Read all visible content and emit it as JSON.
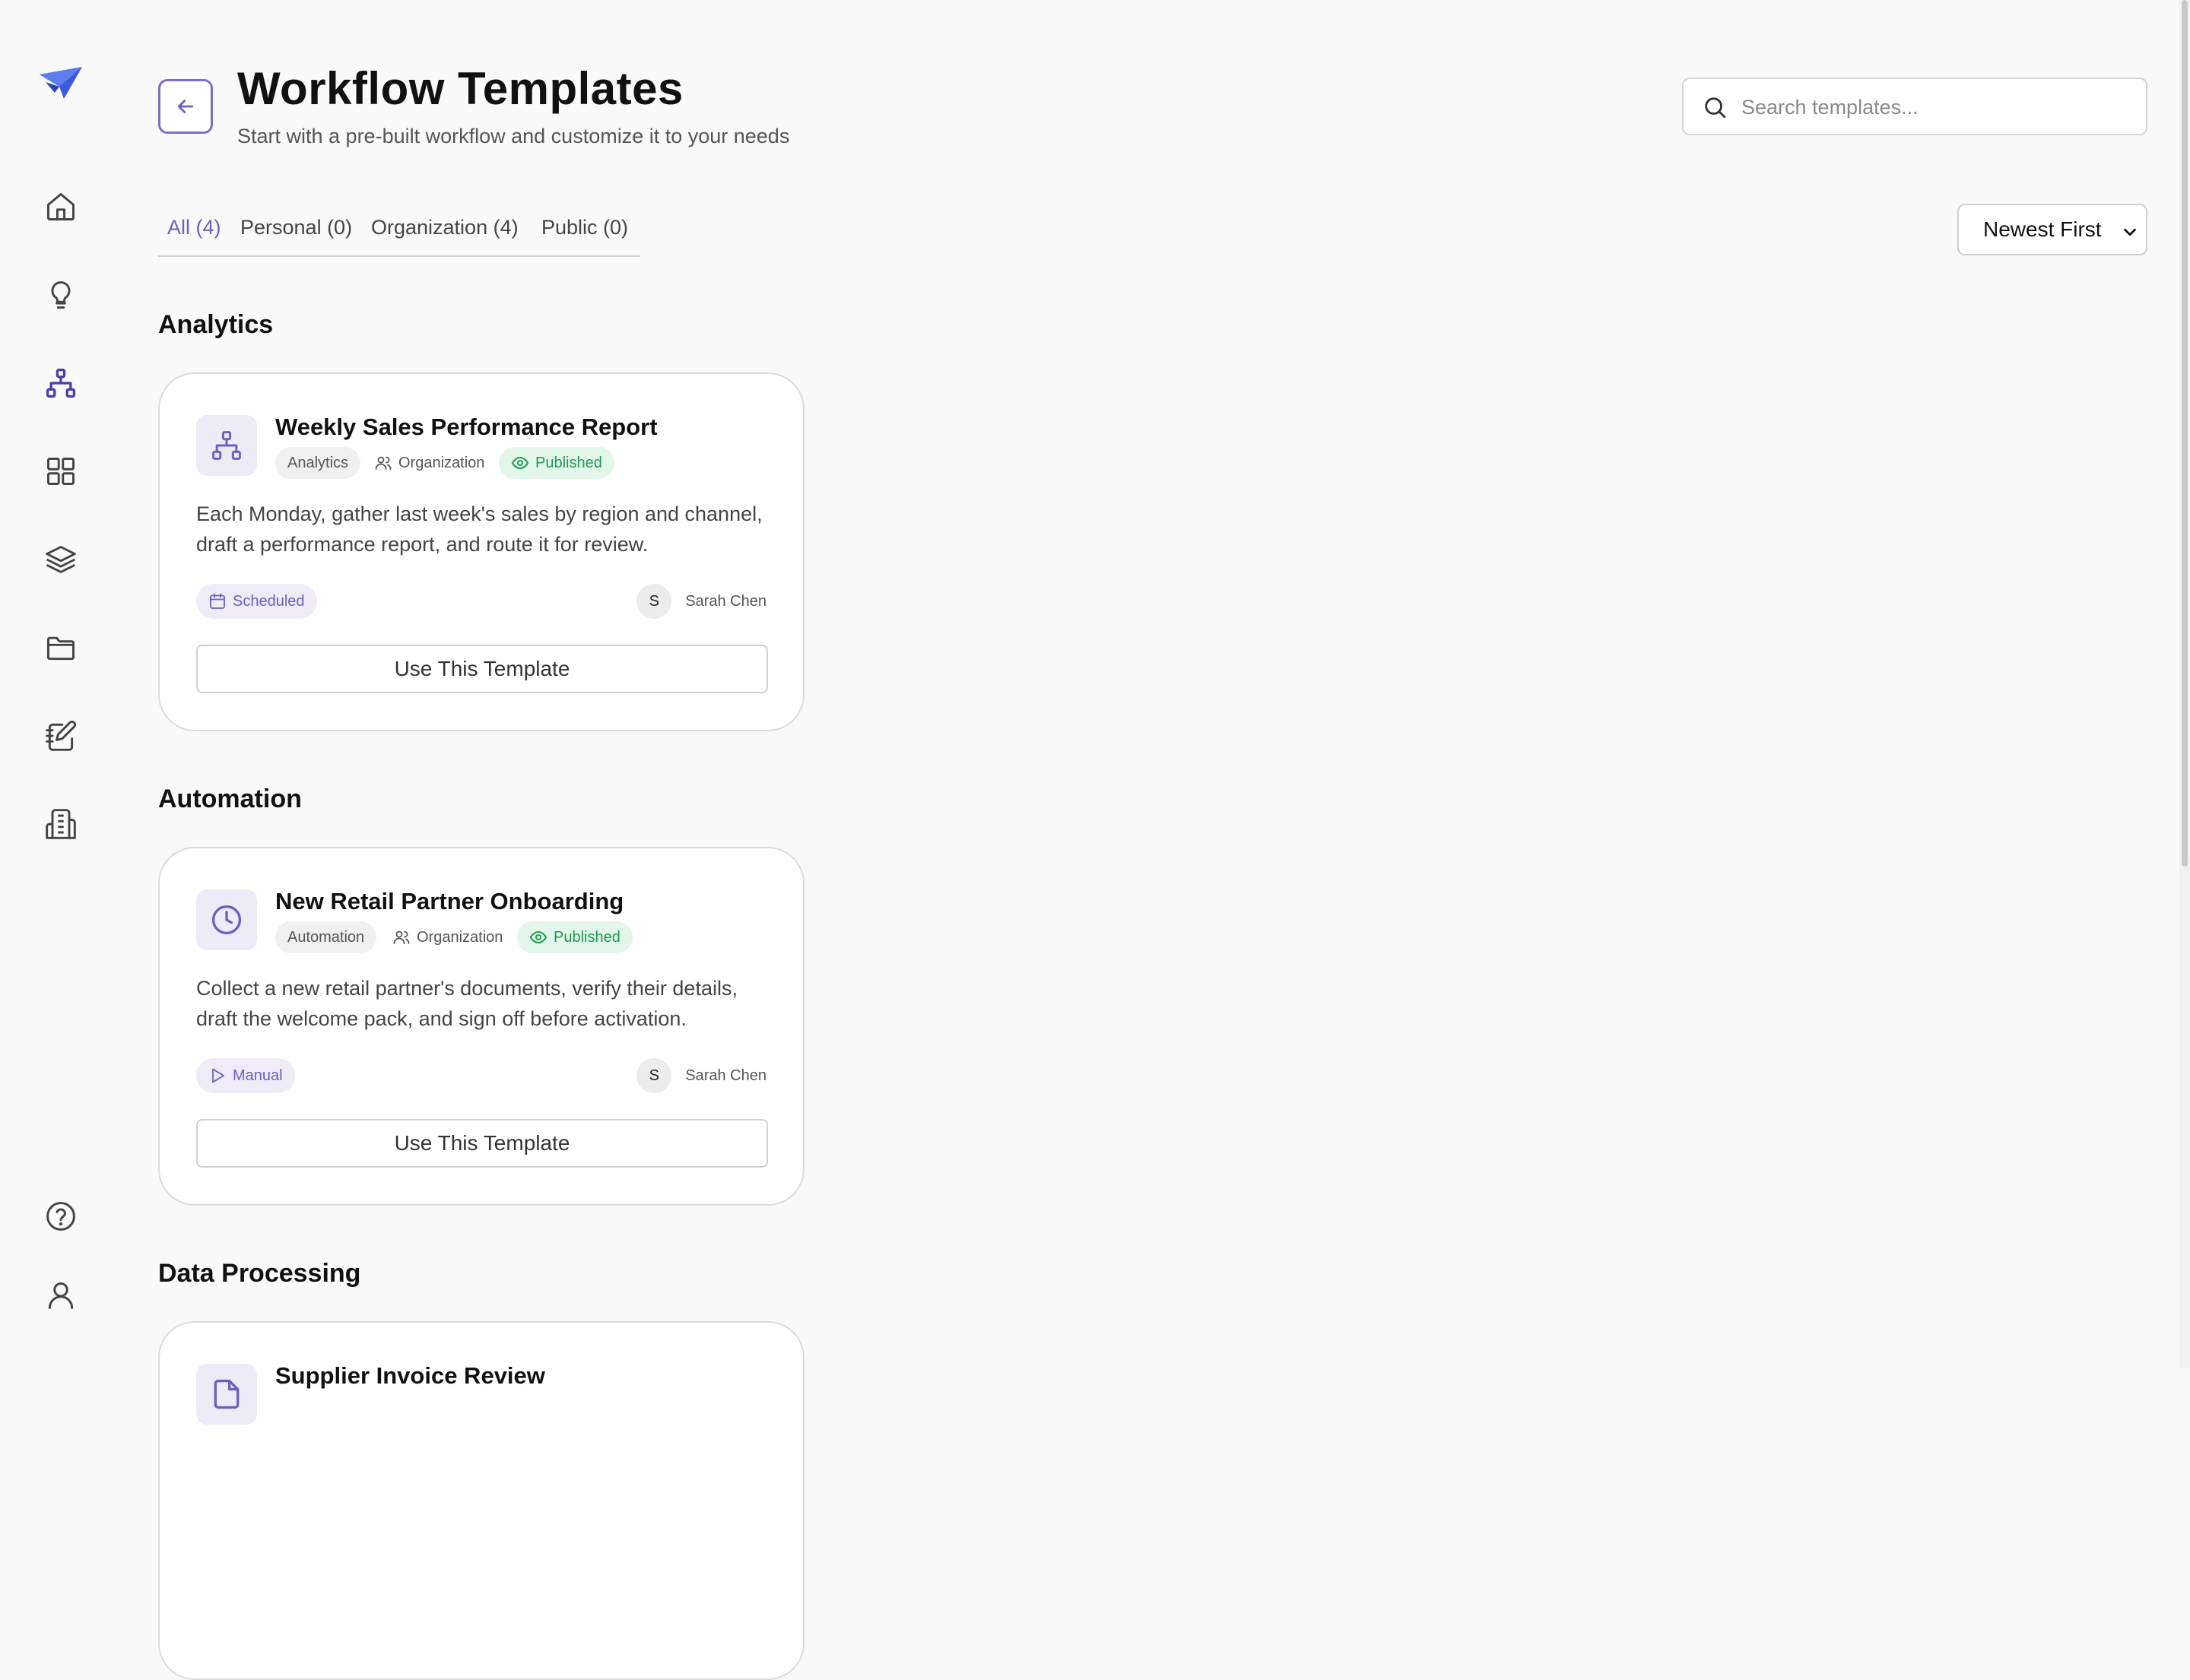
{
  "app": {
    "logo_icon": "paper-plane-logo",
    "accent_color": "#6b5fc0"
  },
  "sidebar": {
    "items": [
      {
        "icon": "home-icon"
      },
      {
        "icon": "lightbulb-icon"
      },
      {
        "icon": "workflow-icon",
        "active": true
      },
      {
        "icon": "grid-icon"
      },
      {
        "icon": "layers-icon"
      },
      {
        "icon": "folder-icon"
      },
      {
        "icon": "notebook-pen-icon"
      },
      {
        "icon": "building-icon"
      }
    ],
    "bottom": [
      {
        "icon": "help-circle-icon"
      },
      {
        "icon": "user-icon"
      }
    ]
  },
  "header": {
    "title": "Workflow Templates",
    "subtitle": "Start with a pre-built workflow and customize it to your needs",
    "search_placeholder": "Search templates..."
  },
  "tabs": [
    {
      "label": "All (4)",
      "active": true
    },
    {
      "label": "Personal (0)"
    },
    {
      "label": "Organization (4)"
    },
    {
      "label": "Public (0)"
    }
  ],
  "sort": {
    "selected": "Newest First"
  },
  "sections": [
    {
      "title": "Analytics",
      "cards": [
        {
          "title": "Weekly Sales Performance Report",
          "icon": "workflow-icon",
          "category": "Analytics",
          "visibility": "Organization",
          "status": "Published",
          "description": "Each Monday, gather last week's sales by region and channel, draft a performance report, and route it for review.",
          "trigger": "Scheduled",
          "trigger_icon": "calendar-icon",
          "author_initial": "S",
          "author": "Sarah Chen",
          "button": "Use This Template"
        }
      ]
    },
    {
      "title": "Automation",
      "cards": [
        {
          "title": "New Retail Partner Onboarding",
          "icon": "clock-icon",
          "category": "Automation",
          "visibility": "Organization",
          "status": "Published",
          "description": "Collect a new retail partner's documents, verify their details, draft the welcome pack, and sign off before activation.",
          "trigger": "Manual",
          "trigger_icon": "play-icon",
          "author_initial": "S",
          "author": "Sarah Chen",
          "button": "Use This Template"
        }
      ]
    },
    {
      "title": "Data Processing",
      "cards": [
        {
          "title": "Supplier Invoice Review",
          "icon": "file-icon"
        }
      ]
    }
  ]
}
